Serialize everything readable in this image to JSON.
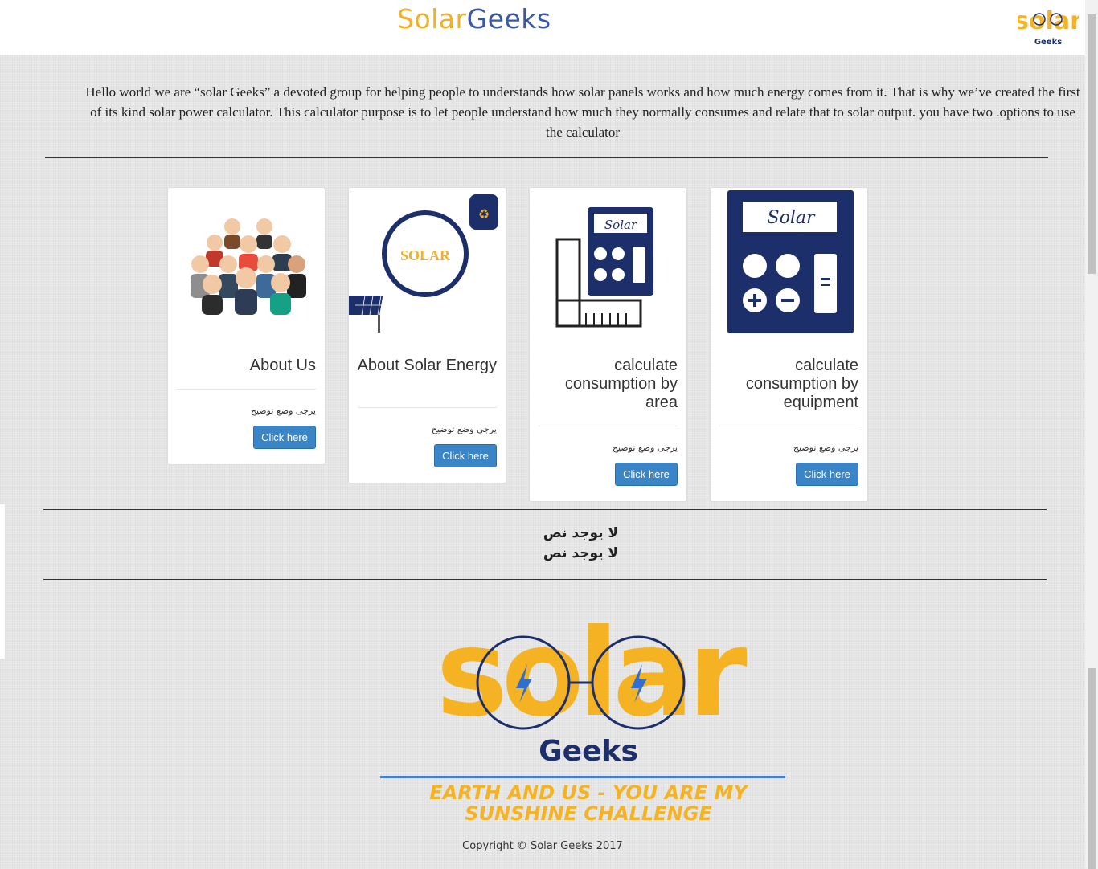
{
  "header": {
    "brand_part1": "Solar",
    "brand_part2": "Geeks",
    "logo_text": "solar",
    "logo_sub": "Geeks"
  },
  "intro": {
    "text": "Hello world we are “solar Geeks” a devoted group for helping people to understands how solar panels works and how much energy comes from it. That is why we’ve created the first of its kind solar power calculator. This calculator purpose is to let people understand how much they normally consumes and relate that to solar output. you have two .options to use the calculator"
  },
  "cards": [
    {
      "title": "About Us",
      "desc": "يرجى وضع توضيح",
      "button": "Click here",
      "icon": "team-people-icon"
    },
    {
      "title": "About Solar Energy",
      "desc": "يرجى وضع توضيح",
      "button": "Click here",
      "icon": "solar-panel-icon",
      "image_text": "SOLAR"
    },
    {
      "title": "calculate consumption by area",
      "desc": "يرجى وضع توضيح",
      "button": "Click here",
      "icon": "area-calculator-icon",
      "image_text": "Solar"
    },
    {
      "title": "calculate consumption by equipment",
      "desc": "يرجى وضع توضيح",
      "button": "Click here",
      "icon": "equipment-calculator-icon",
      "image_text": "Solar"
    }
  ],
  "notext": {
    "line1": "لا يوجد نص",
    "line2": "لا يوجد نص"
  },
  "biglogo": {
    "main": "solar",
    "sub": "Geeks",
    "tagline1": "EARTH AND US - YOU ARE MY",
    "tagline2": "SUNSHINE CHALLENGE"
  },
  "footer": {
    "copyright": "Copyright © Solar Geeks 2017"
  },
  "colors": {
    "brand_orange": "#f2b02a",
    "brand_blue": "#3b5aa6",
    "button_blue": "#3a85c8",
    "navy": "#1d2f6b"
  }
}
